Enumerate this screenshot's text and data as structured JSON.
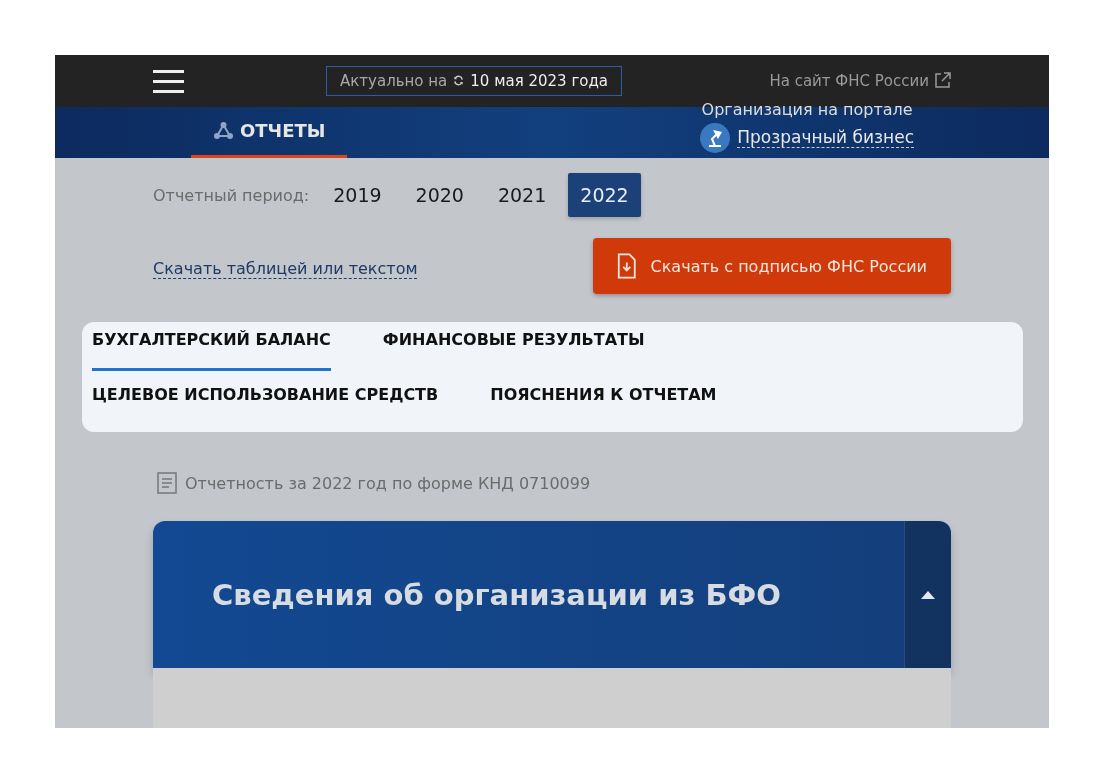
{
  "header": {
    "date_label": "Актуально на",
    "date": "10 мая 2023 года",
    "fns_link": "На сайт ФНС России"
  },
  "nav": {
    "tabs": [
      {
        "label": "ОТЧЕТЫ",
        "selected": true
      }
    ],
    "portal_caption": "Организация на портале",
    "portal_link": "Прозрачный бизнес"
  },
  "period": {
    "label": "Отчетный период:",
    "years": [
      {
        "label": "2019",
        "selected": false
      },
      {
        "label": "2020",
        "selected": false
      },
      {
        "label": "2021",
        "selected": false
      },
      {
        "label": "2022",
        "selected": true
      }
    ]
  },
  "download_link": "Скачать таблицей или текстом",
  "download_button": "Скачать с подписью ФНС России",
  "report_tabs": [
    {
      "label": "БУХГАЛТЕРСКИЙ БАЛАНС",
      "selected": true
    },
    {
      "label": "ФИНАНСОВЫЕ РЕЗУЛЬТАТЫ",
      "selected": false
    },
    {
      "label": "ЦЕЛЕВОЕ ИСПОЛЬЗОВАНИЕ СРЕДСТВ",
      "selected": false
    },
    {
      "label": "ПОЯСНЕНИЯ К ОТЧЕТАМ",
      "selected": false
    }
  ],
  "form_note": "Отчетность за 2022 год по форме КНД 0710099",
  "section": {
    "title": "Сведения об организации из БФО",
    "expanded": true
  }
}
